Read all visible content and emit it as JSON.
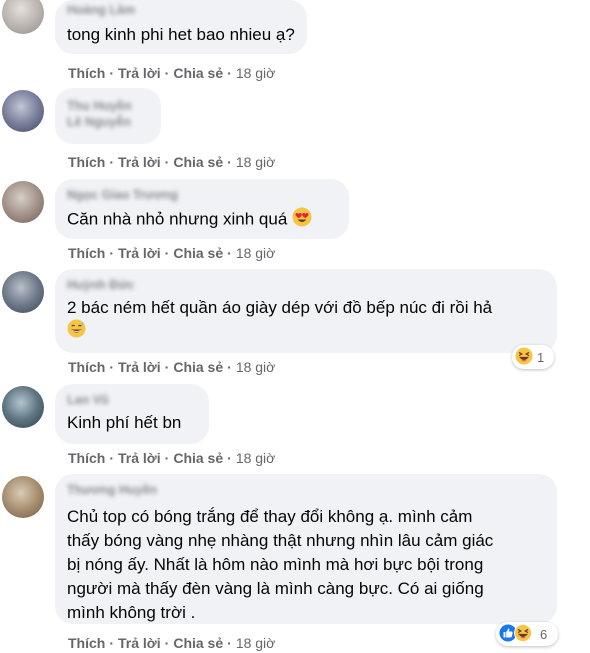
{
  "labels": {
    "like": "Thích",
    "reply": "Trả lời",
    "share": "Chia sẻ",
    "dot": "·"
  },
  "comments": [
    {
      "author": "Hoàng Lâm",
      "text": "tong kinh phi het bao nhieu ạ?",
      "time": "18 giờ"
    },
    {
      "author": "Thu Huyền Lê Nguyễn",
      "text": "",
      "time": "18 giờ"
    },
    {
      "author": "Ngọc Giao Trương",
      "text": "Căn nhà nhỏ nhưng xinh quá",
      "emoji": "heart-eyes-emoji",
      "time": "18 giờ"
    },
    {
      "author": "Huỳnh Đức",
      "text": "2 bác ném hết quần áo giày dép với đồ bếp núc đi rồi hả",
      "emoji": "grinning-sweat-emoji",
      "time": "18 giờ",
      "reaction_count": "1"
    },
    {
      "author": "Lan Vũ",
      "text": "Kinh phí hết bn",
      "time": "18 giờ"
    },
    {
      "author": "Thương Huyền",
      "text_lines": [
        "Chủ top có bóng trắng để thay đổi không ạ. mình cảm",
        "thấy bóng vàng nhẹ nhàng thật nhưng nhìn lâu cảm giác",
        "bị nóng ấy. Nhất là hôm nào mình mà hơi bực bội trong",
        "người mà thấy đèn vàng là mình càng bực. Có ai giống",
        "mình không trời ."
      ],
      "time": "18 giờ",
      "reaction_count": "6"
    }
  ]
}
